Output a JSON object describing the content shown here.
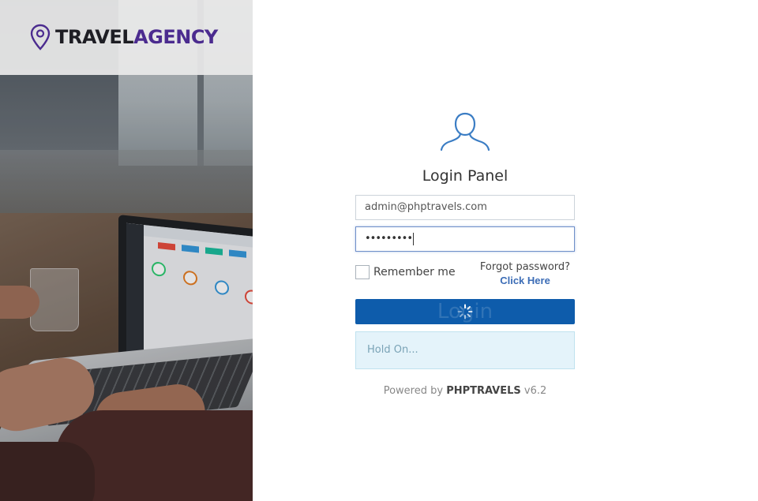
{
  "brand": {
    "part1": "TRAVEL",
    "part2": "AGENCY",
    "accent_color": "#4b2b8f",
    "icon": "map-pin-icon"
  },
  "login": {
    "title": "Login Panel",
    "email_value": "admin@phptravels.com",
    "password_masked": "•••••••••",
    "remember_label": "Remember me",
    "forgot_text": "Forgot password?",
    "forgot_link": "Click Here",
    "button_label": "Login",
    "button_color": "#0e5cab",
    "status_message": "Hold On...",
    "user_icon": "user-icon",
    "spinner_icon": "spinner-icon"
  },
  "footer": {
    "prefix": "Powered by ",
    "brand": "PHPTRAVELS",
    "version": " v6.2"
  }
}
